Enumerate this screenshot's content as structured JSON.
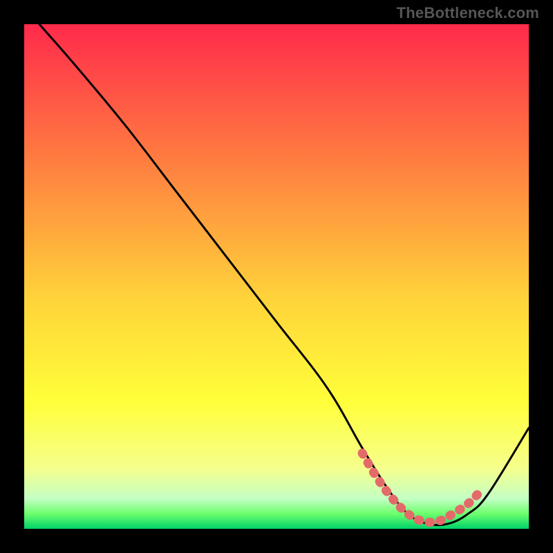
{
  "attribution": "TheBottleneck.com",
  "colors": {
    "background": "#000000",
    "gradient_top": "#ff2a4b",
    "gradient_mid1": "#ff8040",
    "gradient_mid2": "#ffd53a",
    "gradient_mid3": "#ffff3a",
    "gradient_mid4": "#f5ff8c",
    "gradient_bottom1": "#6dff6d",
    "gradient_bottom2": "#00d26a",
    "curve": "#000000",
    "marker": "#e46a6a"
  },
  "chart_data": {
    "type": "line",
    "title": "",
    "xlabel": "",
    "ylabel": "",
    "xlim": [
      0,
      100
    ],
    "ylim": [
      0,
      100
    ],
    "series": [
      {
        "name": "bottleneck-curve",
        "x": [
          3,
          10,
          20,
          30,
          40,
          50,
          60,
          67,
          72,
          76,
          80,
          84,
          88,
          92,
          100
        ],
        "y": [
          100,
          92,
          80,
          67,
          54,
          41,
          28,
          16,
          8,
          3,
          1,
          1,
          3,
          7,
          20
        ]
      }
    ],
    "highlight_segment": {
      "name": "optimal-range",
      "x": [
        67,
        70,
        73,
        76,
        79,
        82,
        85,
        88,
        90
      ],
      "y": [
        15,
        10,
        6,
        3,
        1.5,
        1.5,
        3,
        5,
        7
      ]
    }
  }
}
